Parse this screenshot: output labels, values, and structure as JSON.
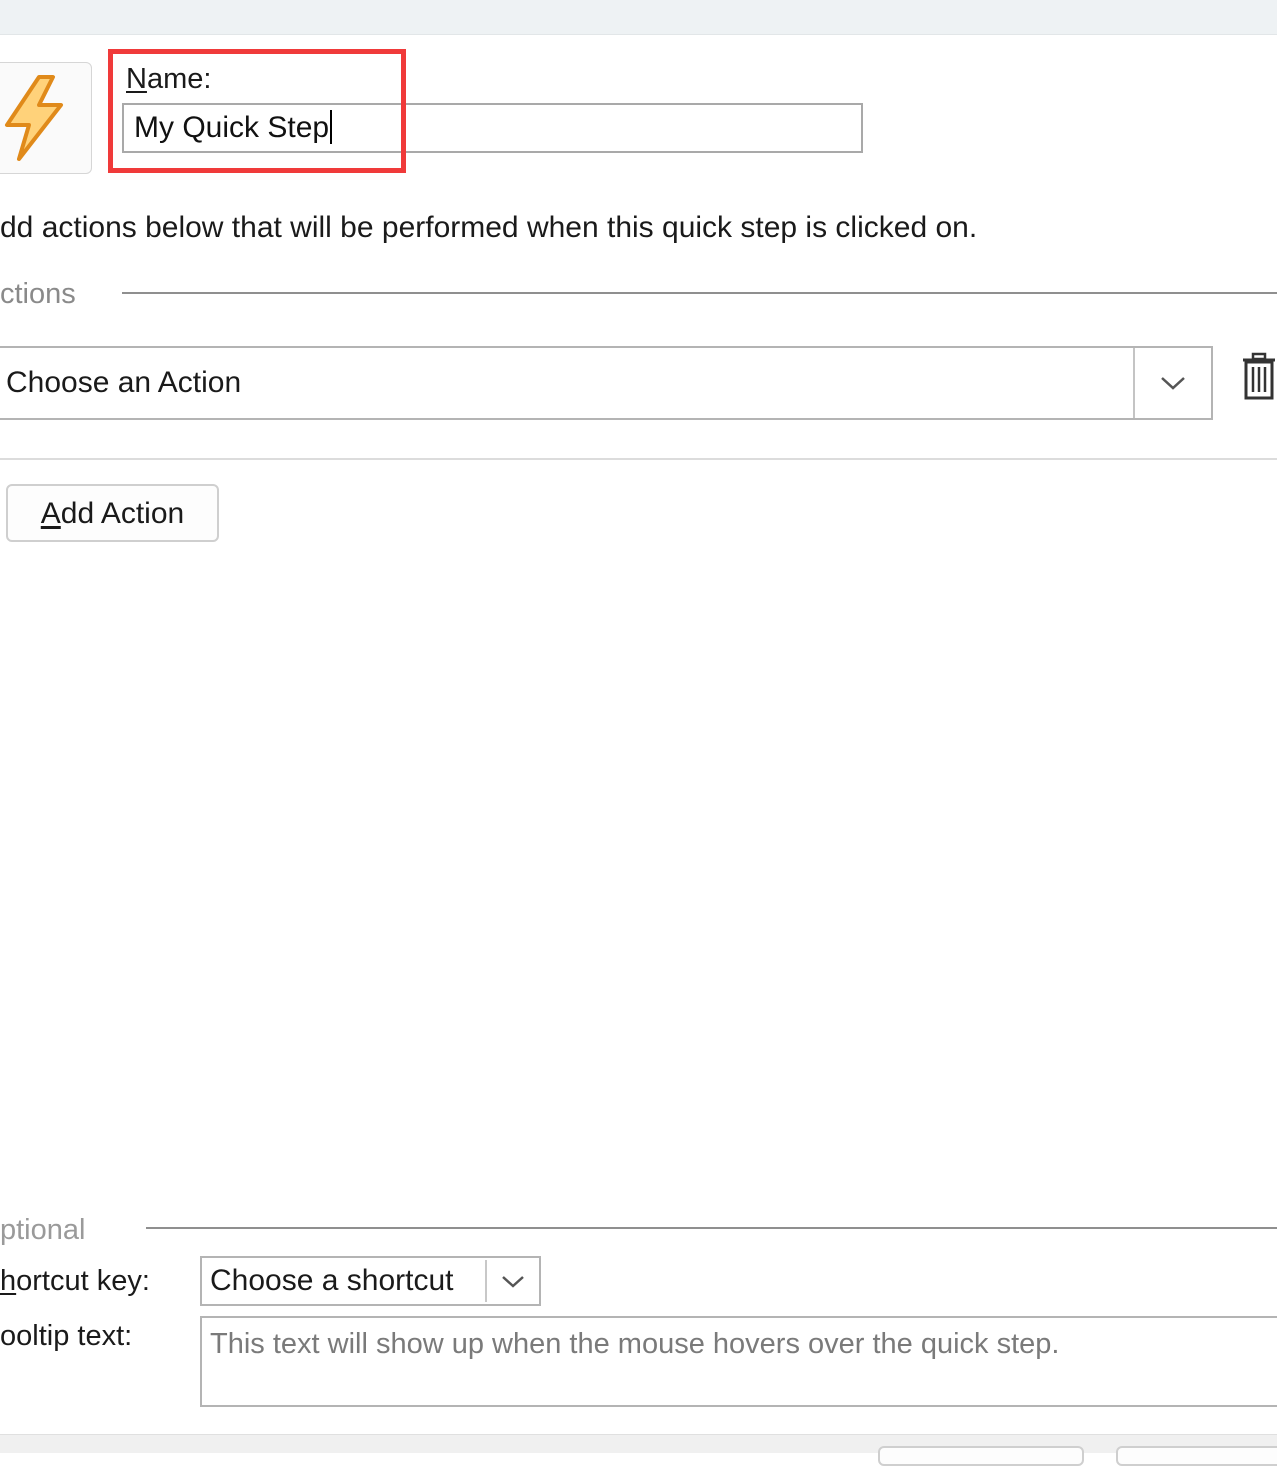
{
  "name": {
    "label_accel": "N",
    "label_rest": "ame:",
    "value": "My Quick Step"
  },
  "quick_step_icon": "lightning-bolt-icon",
  "instructions": "dd actions below that will be performed when this quick step is clicked on.",
  "actions_section": {
    "title": "ctions",
    "action_select_value": "Choose an Action",
    "delete_icon": "trash-icon",
    "add_action_accel": "A",
    "add_action_rest": "dd Action"
  },
  "optional_section": {
    "title": "ptional",
    "shortcut_label_accel": "h",
    "shortcut_label_rest": "ortcut key:",
    "shortcut_value": "Choose a shortcut",
    "tooltip_label": "ooltip text:",
    "tooltip_placeholder": "This text will show up when the mouse hovers over the quick step."
  },
  "colors": {
    "highlight": "#f03a3a",
    "bolt_fill": "#f7a93a",
    "bolt_stroke": "#e08a1a"
  }
}
